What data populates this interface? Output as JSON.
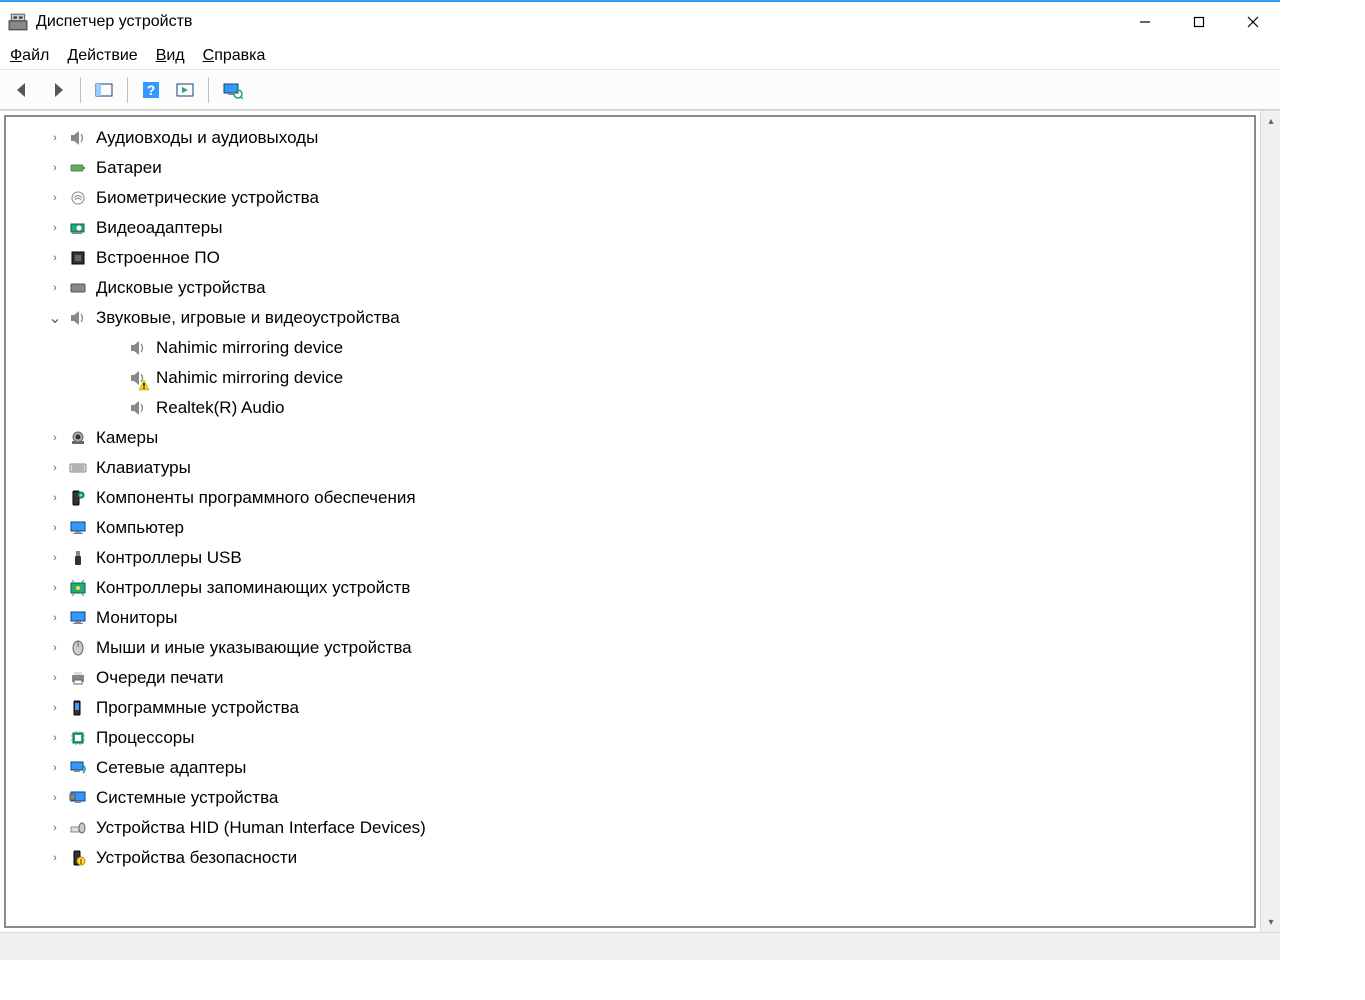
{
  "titlebar": {
    "title": "Диспетчер устройств"
  },
  "menubar": {
    "file": {
      "first": "Ф",
      "rest": "айл"
    },
    "action": {
      "first": "Д",
      "rest": "ействие"
    },
    "view": {
      "first": "В",
      "rest": "ид"
    },
    "help": {
      "first": "С",
      "rest": "правка"
    }
  },
  "tree": {
    "categories": [
      {
        "label": "Аудиовходы и аудиовыходы",
        "icon": "speaker",
        "expanded": false
      },
      {
        "label": "Батареи",
        "icon": "battery",
        "expanded": false
      },
      {
        "label": "Биометрические устройства",
        "icon": "fingerprint",
        "expanded": false
      },
      {
        "label": "Видеоадаптеры",
        "icon": "gpu",
        "expanded": false
      },
      {
        "label": "Встроенное ПО",
        "icon": "firmware",
        "expanded": false
      },
      {
        "label": "Дисковые устройства",
        "icon": "disk",
        "expanded": false
      },
      {
        "label": "Звуковые, игровые и видеоустройства",
        "icon": "speaker",
        "expanded": true,
        "children": [
          {
            "label": "Nahimic mirroring device",
            "icon": "speaker",
            "warn": false
          },
          {
            "label": "Nahimic mirroring device",
            "icon": "speaker",
            "warn": true
          },
          {
            "label": "Realtek(R) Audio",
            "icon": "speaker",
            "warn": false
          }
        ]
      },
      {
        "label": "Камеры",
        "icon": "camera",
        "expanded": false
      },
      {
        "label": "Клавиатуры",
        "icon": "keyboard",
        "expanded": false
      },
      {
        "label": "Компоненты программного обеспечения",
        "icon": "software-component",
        "expanded": false
      },
      {
        "label": "Компьютер",
        "icon": "monitor",
        "expanded": false
      },
      {
        "label": "Контроллеры USB",
        "icon": "usb",
        "expanded": false
      },
      {
        "label": "Контроллеры запоминающих устройств",
        "icon": "storage-controller",
        "expanded": false
      },
      {
        "label": "Мониторы",
        "icon": "monitor",
        "expanded": false
      },
      {
        "label": "Мыши и иные указывающие устройства",
        "icon": "mouse",
        "expanded": false
      },
      {
        "label": "Очереди печати",
        "icon": "printer",
        "expanded": false
      },
      {
        "label": "Программные устройства",
        "icon": "software-device",
        "expanded": false
      },
      {
        "label": "Процессоры",
        "icon": "cpu",
        "expanded": false
      },
      {
        "label": "Сетевые адаптеры",
        "icon": "network",
        "expanded": false
      },
      {
        "label": "Системные устройства",
        "icon": "system",
        "expanded": false
      },
      {
        "label": "Устройства HID (Human Interface Devices)",
        "icon": "hid",
        "expanded": false
      },
      {
        "label": "Устройства безопасности",
        "icon": "security",
        "expanded": false
      }
    ]
  }
}
